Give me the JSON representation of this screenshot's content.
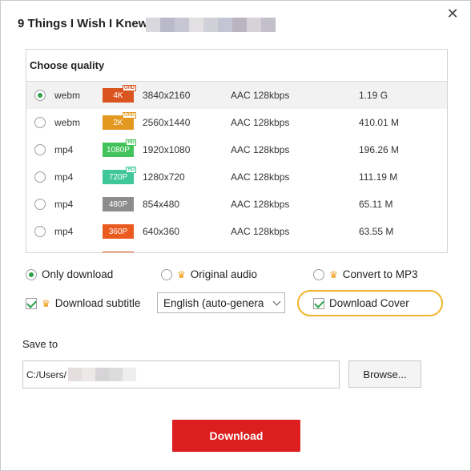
{
  "dialog": {
    "title": "9 Things I Wish I Knew",
    "title_blur_colors": [
      "#d8d8de",
      "#b9b9c9",
      "#c7c7d3",
      "#e2e0e2",
      "#d0d0d8",
      "#c4c5d4",
      "#b9b4c0",
      "#d7d2d8",
      "#c3c0cb"
    ],
    "close_glyph": "✕"
  },
  "quality": {
    "header": "Choose quality",
    "rows": [
      {
        "format": "webm",
        "badge": "4K",
        "badge_color": "#d9541e",
        "tag": "UHD",
        "resolution": "3840x2160",
        "audio": "AAC 128kbps",
        "size": "1.19 G",
        "selected": true
      },
      {
        "format": "webm",
        "badge": "2K",
        "badge_color": "#e39820",
        "tag": "UHD",
        "resolution": "2560x1440",
        "audio": "AAC 128kbps",
        "size": "410.01 M",
        "selected": false
      },
      {
        "format": "mp4",
        "badge": "1080P",
        "badge_color": "#41c25a",
        "tag": "HD",
        "resolution": "1920x1080",
        "audio": "AAC 128kbps",
        "size": "196.26 M",
        "selected": false
      },
      {
        "format": "mp4",
        "badge": "720P",
        "badge_color": "#3fc79a",
        "tag": "HD",
        "resolution": "1280x720",
        "audio": "AAC 128kbps",
        "size": "111.19 M",
        "selected": false
      },
      {
        "format": "mp4",
        "badge": "480P",
        "badge_color": "#8c8c8c",
        "tag": "",
        "resolution": "854x480",
        "audio": "AAC 128kbps",
        "size": "65.11 M",
        "selected": false
      },
      {
        "format": "mp4",
        "badge": "360P",
        "badge_color": "#ea5a1f",
        "tag": "",
        "resolution": "640x360",
        "audio": "AAC 128kbps",
        "size": "63.55 M",
        "selected": false
      },
      {
        "format": "",
        "badge": "",
        "badge_color": "#ea5a1f",
        "tag": "",
        "resolution": "",
        "audio": "",
        "size": "",
        "selected": false
      }
    ]
  },
  "options": {
    "only_download": "Only download",
    "original_audio": "Original audio",
    "convert_mp3": "Convert to MP3",
    "download_subtitle": "Download subtitle",
    "subtitle_language": "English (auto-genera",
    "download_cover": "Download Cover",
    "crown_glyph": "♛",
    "highlight_color": "#f0b429"
  },
  "save": {
    "label": "Save to",
    "path_prefix": "C:/Users/",
    "path_blur_colors": [
      "#e4dede",
      "#ece8e8",
      "#d7d4d7",
      "#dcdcdc",
      "#eeeeee"
    ],
    "browse_label": "Browse..."
  },
  "download_label": "Download",
  "accent": "#dd1e1e",
  "check_color": "#2ea44f"
}
